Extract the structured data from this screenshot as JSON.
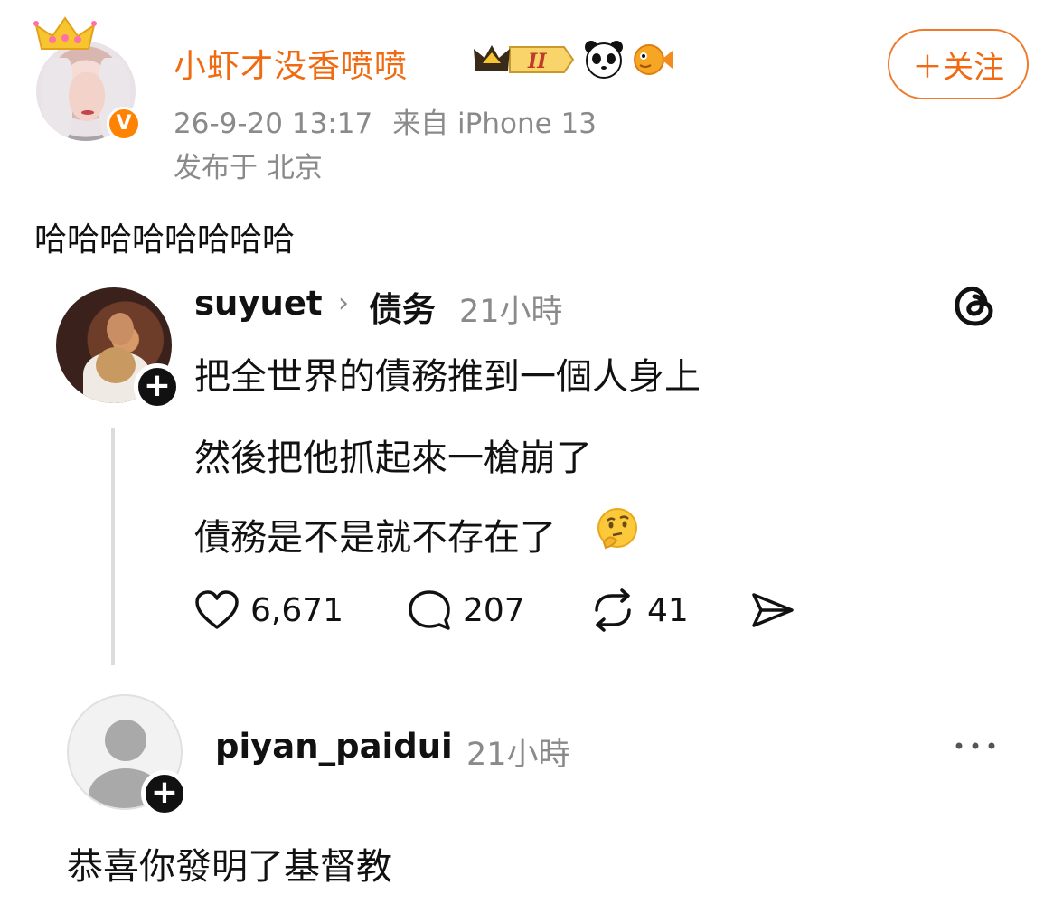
{
  "weibo_post": {
    "author": "小虾才没香喷喷",
    "verified_badge": "V",
    "vip_badge_text": "II",
    "date": "26-9-20 13:17",
    "source": "来自 iPhone 13",
    "location": "发布于 北京",
    "follow_label": "＋关注",
    "text": "哈哈哈哈哈哈哈哈",
    "brand_color": "#ef6a10"
  },
  "threads_post": {
    "username": "suyuet",
    "topic": "债务",
    "time": "21小時",
    "lines": [
      "把全世界的債務推到一個人身上",
      "然後把他抓起來一槍崩了",
      "債務是不是就不存在了"
    ],
    "emoji": "thinking-face",
    "likes": "6,671",
    "comments": "207",
    "reposts": "41"
  },
  "threads_reply": {
    "username": "piyan_paidui",
    "time": "21小時",
    "text": "恭喜你發明了基督教"
  },
  "plus_symbol": "+",
  "chevron": "›"
}
